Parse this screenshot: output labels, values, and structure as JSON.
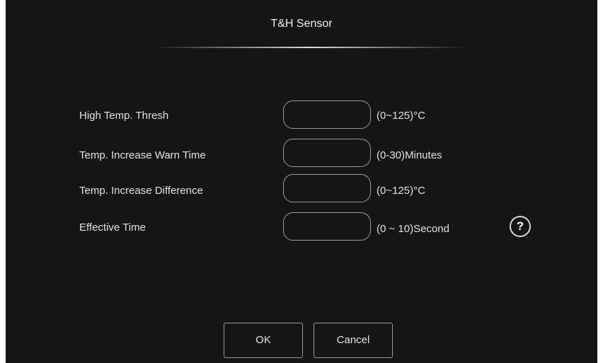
{
  "dialog": {
    "title": "T&H Sensor"
  },
  "fields": [
    {
      "label": "High Temp. Thresh",
      "value": "",
      "unit": "(0~125)°C"
    },
    {
      "label": "Temp. Increase Warn Time",
      "value": "",
      "unit": "(0-30)Minutes"
    },
    {
      "label": "Temp. Increase Difference",
      "value": "",
      "unit": "(0~125)°C"
    },
    {
      "label": "Effective Time",
      "value": "",
      "unit": "(0 ~ 10)Second"
    }
  ],
  "help": {
    "icon": "question-icon",
    "glyph": "?"
  },
  "buttons": {
    "ok_label": "OK",
    "cancel_label": "Cancel"
  },
  "colors": {
    "background": "#151515",
    "text": "#e2e2e2",
    "border": "#9a9a9a"
  }
}
